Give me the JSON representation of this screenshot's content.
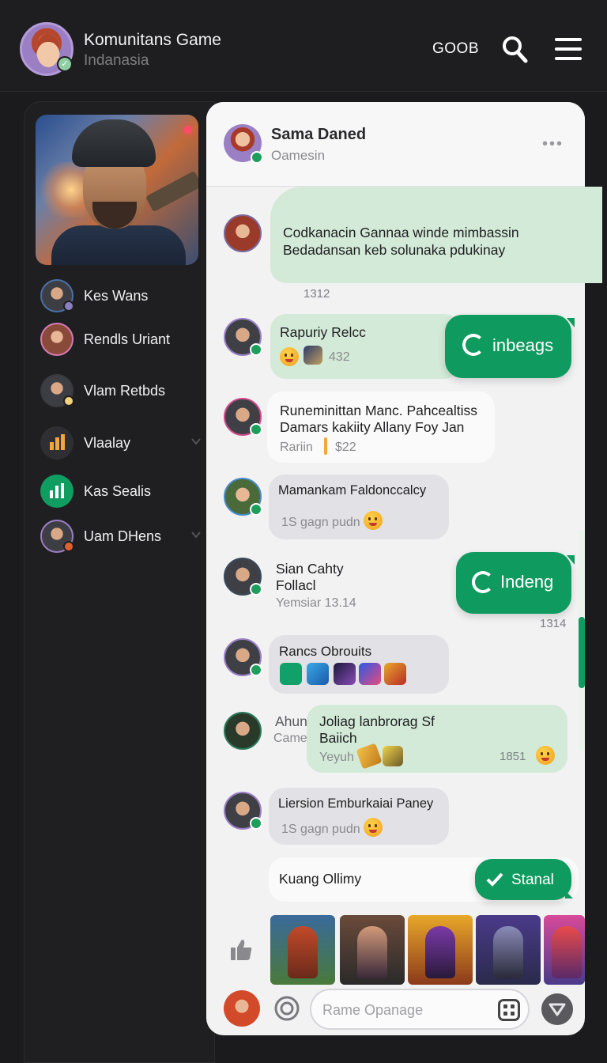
{
  "header": {
    "title": "Komunitans Game",
    "subtitle": "Indanasia",
    "code": "GOOB",
    "icons": [
      "search-icon",
      "menu-icon"
    ]
  },
  "sidebar": {
    "items": [
      {
        "label": "Kes Wans",
        "badge_color": "#8a7fc4"
      },
      {
        "label": "Rendls Uriant",
        "badge_color": "#d57ab2"
      },
      {
        "label": "Vlam Retbds",
        "badge_color": "#f2d27a"
      },
      {
        "label": "Vlaalay",
        "icon": "bar-chart-icon",
        "expandable": true
      },
      {
        "label": "Kas Sealis",
        "icon": "chart-icon"
      },
      {
        "label": "Uam DHens",
        "badge_color": "#e0602e",
        "expandable": true
      }
    ]
  },
  "chat": {
    "name": "Sama Daned",
    "status": "Oamesin",
    "messages": [
      {
        "line1": "Codkanacin Gannaa winde mimbassin",
        "line2": "Bedadansan keb solunaka pdukinay",
        "time": "1312"
      },
      {
        "title": "Rapuriy Relcc",
        "count": "432",
        "action": "inbeags"
      },
      {
        "line1": "Runeminittan Manc. Pahcealtiss",
        "line2": "Damars kakiity Allany Foy Jan",
        "meta_left": "Rariin",
        "meta_right": "$22"
      },
      {
        "title": "Mamankam Faldonccalcy",
        "sub": "1S gagn pudn"
      },
      {
        "line1": "Sian Cahty",
        "line2": "Follacl",
        "sub": "Yemsiar 13.14",
        "action": "Indeng",
        "time": "1314"
      },
      {
        "title": "Rancs Obrouits",
        "icons": [
          "game-icon-1",
          "game-icon-2",
          "game-icon-3",
          "game-icon-4",
          "game-icon-5"
        ]
      },
      {
        "side_name": "Ahun",
        "side_sub": "Came",
        "line1": "Joliag lanbrorag Sf",
        "line2": "Baiich",
        "sub": "Yeyuh",
        "time": "1851"
      },
      {
        "title": "Liersion Emburkaiai Paney",
        "sub": "1S gagn pudn"
      },
      {
        "title": "Kuang Ollimy",
        "action": "Stanal"
      }
    ],
    "thumbnails": [
      "warrior-thumbnail",
      "assassin-thumbnail",
      "mage-thumbnail",
      "knight-thumbnail",
      "brawler-thumbnail"
    ]
  },
  "composer": {
    "placeholder": "Rame Opanage"
  },
  "colors": {
    "accent": "#0f9b5f",
    "bubble_green": "#d3ead8",
    "background": "#1b1b1d"
  }
}
